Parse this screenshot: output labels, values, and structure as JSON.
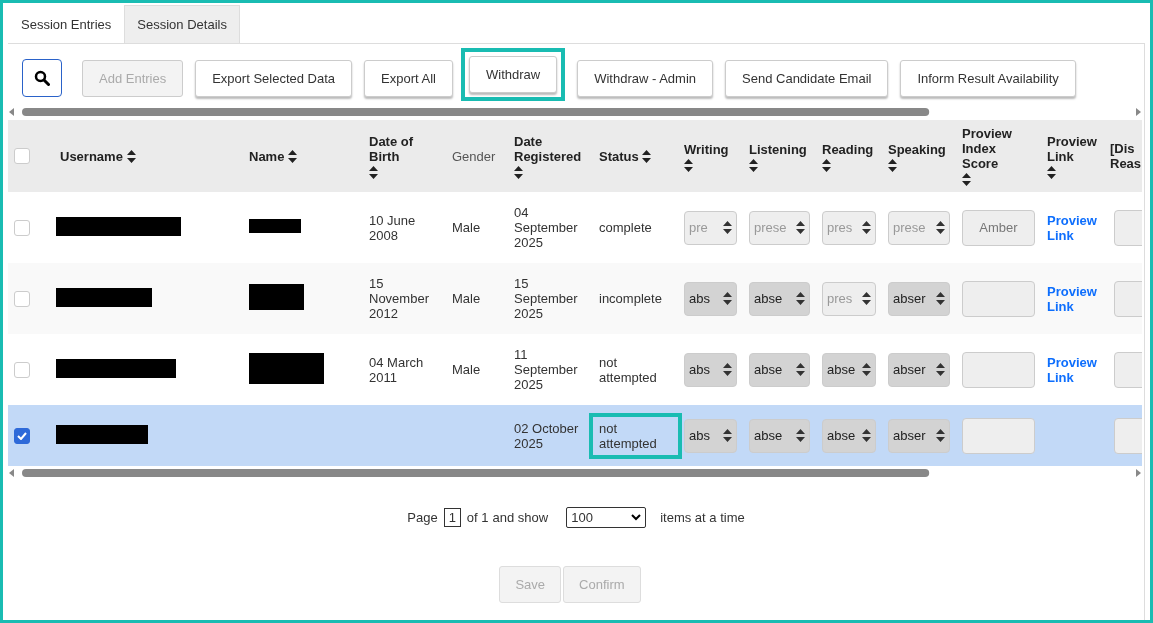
{
  "tabs": [
    {
      "label": "Session Entries",
      "selected": true
    },
    {
      "label": "Session Details",
      "selected": false
    }
  ],
  "toolbar": {
    "buttons": [
      {
        "label": "Add Entries",
        "disabled": true,
        "highlighted": false
      },
      {
        "label": "Export Selected Data",
        "disabled": false,
        "highlighted": false
      },
      {
        "label": "Export All",
        "disabled": false,
        "highlighted": false
      },
      {
        "label": "Withdraw",
        "disabled": false,
        "highlighted": true
      },
      {
        "label": "Withdraw - Admin",
        "disabled": false,
        "highlighted": false
      },
      {
        "label": "Send Candidate Email",
        "disabled": false,
        "highlighted": false
      },
      {
        "label": "Inform Result Availability",
        "disabled": false,
        "highlighted": false
      }
    ]
  },
  "table": {
    "select_all_checked": false,
    "columns": [
      {
        "label": "Username",
        "sortable": true,
        "muted": false
      },
      {
        "label": "Name",
        "sortable": true,
        "muted": false
      },
      {
        "label": "Date of Birth",
        "sortable": true,
        "muted": false
      },
      {
        "label": "Gender",
        "sortable": false,
        "muted": true
      },
      {
        "label": "Date Registered",
        "sortable": true,
        "muted": false
      },
      {
        "label": "Status",
        "sortable": true,
        "muted": false
      },
      {
        "label": "Writing",
        "sortable": true,
        "muted": false
      },
      {
        "label": "Listening",
        "sortable": true,
        "muted": false
      },
      {
        "label": "Reading",
        "sortable": true,
        "muted": false
      },
      {
        "label": "Speaking",
        "sortable": true,
        "muted": false
      },
      {
        "label": "Proview Index Score",
        "sortable": true,
        "muted": false
      },
      {
        "label": "Proview Link",
        "sortable": true,
        "muted": false
      },
      {
        "label": "[Dis Reas",
        "sortable": false,
        "muted": false
      }
    ],
    "rows": [
      {
        "selected": false,
        "username_redacted": true,
        "name_redacted": true,
        "date_of_birth": "10 June 2008",
        "gender": "Male",
        "date_registered": "04 September 2025",
        "status": "complete",
        "status_highlighted": false,
        "skills": [
          {
            "value": "pre",
            "disabled": true
          },
          {
            "value": "prese",
            "disabled": true
          },
          {
            "value": "pres",
            "disabled": true
          },
          {
            "value": "prese",
            "disabled": true
          }
        ],
        "index_score": "Amber",
        "link": "Proview Link"
      },
      {
        "selected": false,
        "username_redacted": true,
        "name_redacted": true,
        "date_of_birth": "15 November 2012",
        "gender": "Male",
        "date_registered": "15 September 2025",
        "status": "incomplete",
        "status_highlighted": false,
        "skills": [
          {
            "value": "abs",
            "disabled": false
          },
          {
            "value": "abse",
            "disabled": false
          },
          {
            "value": "pres",
            "disabled": true
          },
          {
            "value": "abser",
            "disabled": false
          }
        ],
        "link": "Proview Link"
      },
      {
        "selected": false,
        "username_redacted": true,
        "name_redacted": true,
        "date_of_birth": "04 March 2011",
        "gender": "Male",
        "date_registered": "11 September 2025",
        "status": "not attempted",
        "status_highlighted": false,
        "skills": [
          {
            "value": "abs",
            "disabled": false
          },
          {
            "value": "abse",
            "disabled": false
          },
          {
            "value": "abse",
            "disabled": false
          },
          {
            "value": "abser",
            "disabled": false
          }
        ],
        "link": "Proview Link"
      },
      {
        "selected": true,
        "username_redacted": true,
        "name_redacted": false,
        "date_registered": "02 October 2025",
        "status": "not attempted",
        "status_highlighted": true,
        "skills": [
          {
            "value": "abs",
            "disabled": false
          },
          {
            "value": "abse",
            "disabled": false
          },
          {
            "value": "abse",
            "disabled": false
          },
          {
            "value": "abser",
            "disabled": false
          }
        ]
      }
    ]
  },
  "pagination": {
    "page_label": "Page",
    "page": "1",
    "of_label": "of 1",
    "show_label": "and show",
    "page_size": "100",
    "suffix": "items at a time"
  },
  "footer_buttons": [
    {
      "label": "Save",
      "disabled": true
    },
    {
      "label": "Confirm",
      "disabled": true
    }
  ]
}
